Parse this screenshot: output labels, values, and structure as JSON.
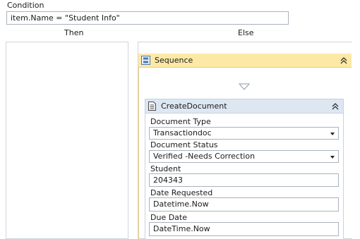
{
  "condition": {
    "label": "Condition",
    "expression": "item.Name  = \"Student Info\""
  },
  "branches": {
    "then_label": "Then",
    "else_label": "Else"
  },
  "sequence": {
    "title": "Sequence",
    "icon": "sequence-icon"
  },
  "activity": {
    "title": "CreateDocument",
    "icon": "document-icon",
    "fields": {
      "document_type": {
        "label": "Document Type",
        "value": "Transactiondoc"
      },
      "document_status": {
        "label": "Document Status",
        "value": "Verified -Needs Correction"
      },
      "student": {
        "label": "Student",
        "value": "204343"
      },
      "date_requested": {
        "label": "Date Requested",
        "value": "Datetime.Now"
      },
      "due_date": {
        "label": "Due Date",
        "value": "DateTime.Now"
      }
    }
  },
  "colors": {
    "sequence_header": "#fde9a6",
    "activity_header": "#dde7f2",
    "border": "#cfd5dc"
  }
}
